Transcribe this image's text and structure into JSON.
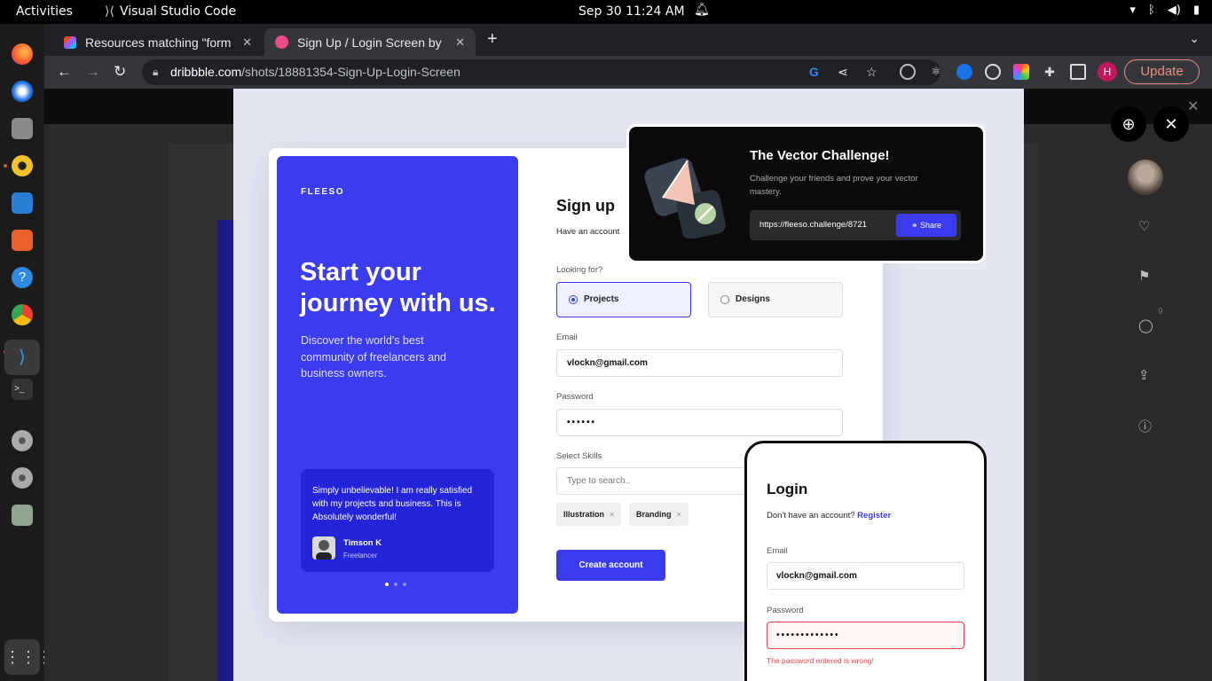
{
  "system": {
    "activities": "Activities",
    "app_name": "Visual Studio Code",
    "clock": "Sep 30  11:24 AM"
  },
  "browser": {
    "tabs": [
      {
        "title": "Resources matching \"form",
        "favicon": "figma-icon"
      },
      {
        "title": "Sign Up / Login Screen by",
        "favicon": "dribbble-icon"
      }
    ],
    "url_host": "dribbble.com",
    "url_path": "/shots/18881354-Sign-Up-Login-Screen",
    "update_label": "Update",
    "profile_initial": "H"
  },
  "side_rail": {
    "comment_count": "9"
  },
  "design": {
    "brand": "FLEESO",
    "hero": "Start your journey with us.",
    "subtitle": "Discover the world's best community of freelancers and business owners.",
    "testimonial": {
      "quote": "Simply unbelievable! I am really satisfied with my projects and business. This is Absolutely wonderful!",
      "name": "Timson K",
      "role": "Freelancer"
    },
    "signup": {
      "title": "Sign up",
      "subtitle": "Have an account",
      "looking_for_label": "Looking for?",
      "option_projects": "Projects",
      "option_designs": "Designs",
      "email_label": "Email",
      "email_value": "vlockn@gmail.com",
      "password_label": "Password",
      "password_value": "••••••",
      "skills_label": "Select Skills",
      "skills_placeholder": "Type to search..",
      "chips": [
        "Illustration",
        "Branding"
      ],
      "cta": "Create account"
    },
    "vector_challenge": {
      "title": "The Vector Challenge!",
      "subtitle": "Challenge your friends and prove your vector mastery.",
      "link": "https://fleeso.challenge/8721",
      "share": "Share"
    },
    "login": {
      "title": "Login",
      "prompt": "Don't have an account?",
      "register": "Register",
      "email_label": "Email",
      "email_value": "vlockn@gmail.com",
      "password_label": "Password",
      "password_value": "•••••••••••••",
      "error": "The password entered is wrong!"
    }
  }
}
